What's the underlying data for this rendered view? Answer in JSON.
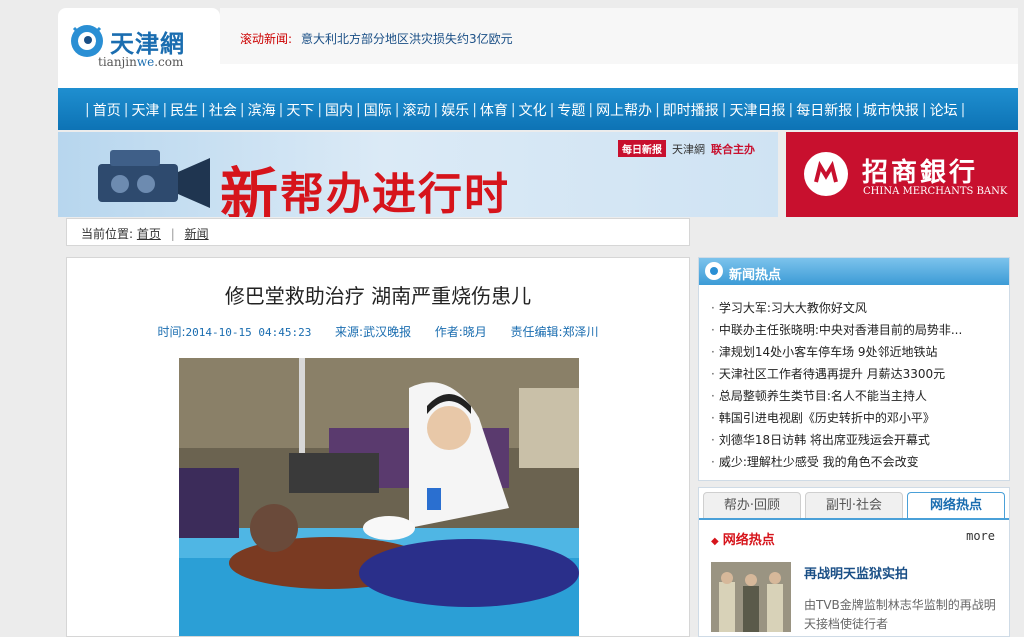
{
  "header": {
    "logo_cn": "天津網",
    "logo_en_a": "tianjin",
    "logo_en_b": "we",
    "logo_en_c": ".com",
    "ticker_label": "滚动新闻:",
    "ticker_text": "意大利北方部分地区洪灾损失约3亿欧元"
  },
  "nav": {
    "items": [
      "首页",
      "天津",
      "民生",
      "社会",
      "滨海",
      "天下",
      "国内",
      "国际",
      "滚动",
      "娱乐",
      "体育",
      "文化",
      "专题",
      "网上帮办",
      "即时播报",
      "天津日报",
      "每日新报",
      "城市快报",
      "论坛"
    ]
  },
  "banner": {
    "title_big": "新",
    "title_rest": "帮办进行时",
    "partner_paper": "每日新报",
    "partner_site": "天津網",
    "partner_host": "联合主办",
    "ad_cn": "招商銀行",
    "ad_en": "CHINA MERCHANTS BANK"
  },
  "breadcrumb": {
    "label": "当前位置:",
    "home": "首页",
    "section": "新闻"
  },
  "article": {
    "title": "修巴堂救助治疗  湖南严重烧伤患儿",
    "time_label": "时间:",
    "time_value": "2014-10-15 04:45:23",
    "source_label": "来源:",
    "source_value": "武汉晚报",
    "author_label": "作者:",
    "author_value": "晓月",
    "editor_label": "责任编辑:",
    "editor_value": "郑泽川"
  },
  "hot_news": {
    "title": "新闻热点",
    "items": [
      "学习大军:习大大教你好文风",
      "中联办主任张晓明:中央对香港目前的局势非...",
      "津规划14处小客车停车场 9处邻近地铁站",
      "天津社区工作者待遇再提升 月薪达3300元",
      "总局整顿养生类节目:名人不能当主持人",
      "韩国引进电视剧《历史转折中的邓小平》",
      "刘德华18日访韩 将出席亚残运会开幕式",
      "威少:理解杜少感受 我的角色不会改变"
    ]
  },
  "tabs": {
    "items": [
      "帮办·回顾",
      "副刊·社会",
      "网络热点"
    ],
    "active_index": 2,
    "sub_title": "网络热点",
    "more": "more",
    "feature_title": "再战明天监狱实拍",
    "feature_desc": "由TVB金牌监制林志华监制的再战明天接档使徒行者"
  },
  "colors": {
    "nav_blue": "#0d73b5",
    "accent_red": "#d6141b",
    "link_blue": "#1a6db0",
    "cmb_red": "#c8102e"
  }
}
